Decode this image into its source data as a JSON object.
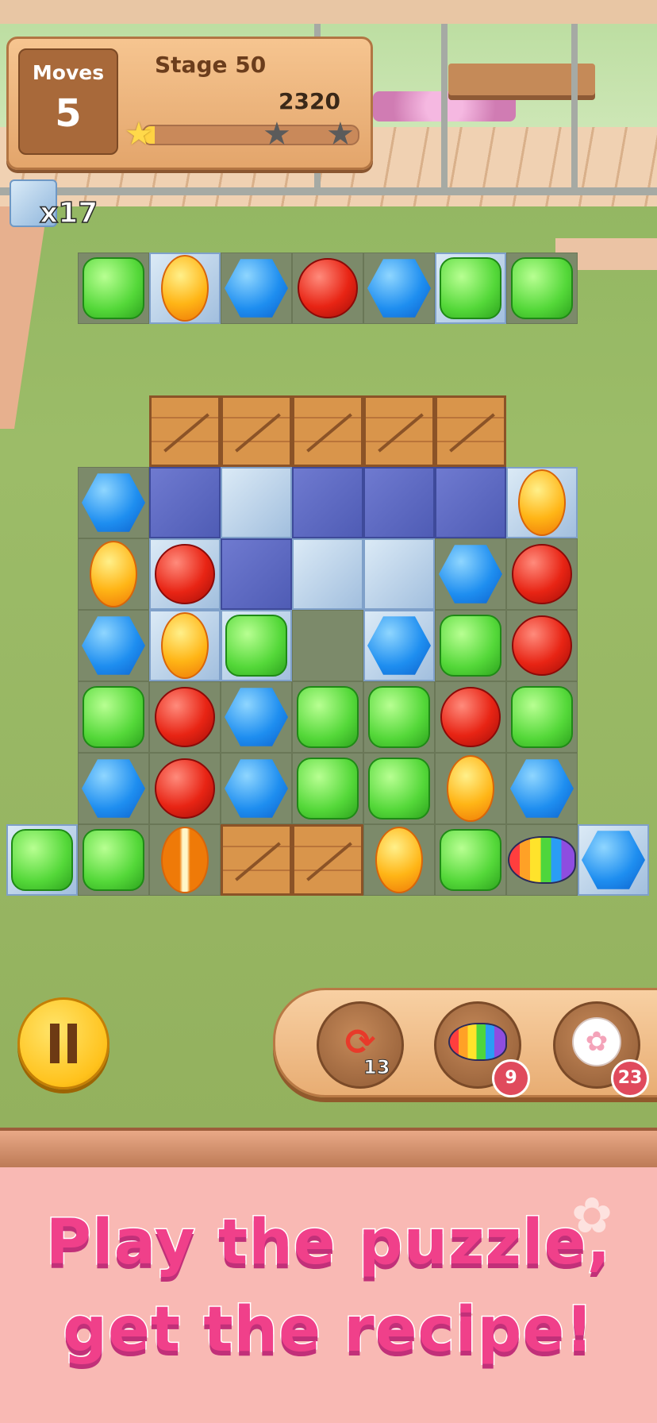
{
  "hud": {
    "moves_label": "Moves",
    "moves_value": "5",
    "stage_label": "Stage 50",
    "score": "2320",
    "progress_fraction": 0.05,
    "stars_earned": 1,
    "stars_total": 3
  },
  "goal": {
    "icon": "ice-block-icon",
    "count": "x17"
  },
  "board": {
    "cols": 9,
    "rows": 10,
    "cells": [
      [
        null,
        "green",
        "orange@ice",
        "blue",
        "red",
        "blue",
        "green@ice",
        "green",
        null
      ],
      [
        null,
        null,
        null,
        null,
        null,
        null,
        null,
        null,
        null
      ],
      [
        null,
        null,
        "crate",
        "crate",
        "crate",
        "crate",
        "crate",
        null,
        null
      ],
      [
        null,
        "blue",
        "empty@ice-dark",
        "empty@ice",
        "empty@ice-dark",
        "empty@ice-dark",
        "empty@ice-dark",
        "orange@ice",
        null
      ],
      [
        null,
        "orange",
        "red@ice",
        "empty@ice-dark",
        "empty@ice",
        "empty@ice",
        "blue",
        "red",
        null
      ],
      [
        null,
        "blue",
        "orange@ice",
        "green@ice",
        "empty",
        "blue@ice",
        "green",
        "red",
        null
      ],
      [
        null,
        "green",
        "red",
        "blue",
        "green",
        "green",
        "red",
        "green",
        null
      ],
      [
        null,
        "blue",
        "red",
        "blue",
        "green",
        "green",
        "orange",
        "blue",
        null
      ],
      [
        "green@ice",
        "green",
        "orange-striped",
        "crate",
        "crate",
        "orange",
        "green",
        "fish-special",
        "blue@ice"
      ]
    ]
  },
  "pause": {
    "icon": "pause-icon"
  },
  "boosters": [
    {
      "name": "shuffle",
      "icon": "shuffle-icon",
      "count": "13"
    },
    {
      "name": "rainbow-fish",
      "icon": "rainbow-fish-icon",
      "count": "9"
    },
    {
      "name": "cat-paw",
      "icon": "cat-paw-icon",
      "count": "23"
    }
  ],
  "banner": {
    "line1": "Play the puzzle,",
    "line2": "get the recipe!"
  }
}
